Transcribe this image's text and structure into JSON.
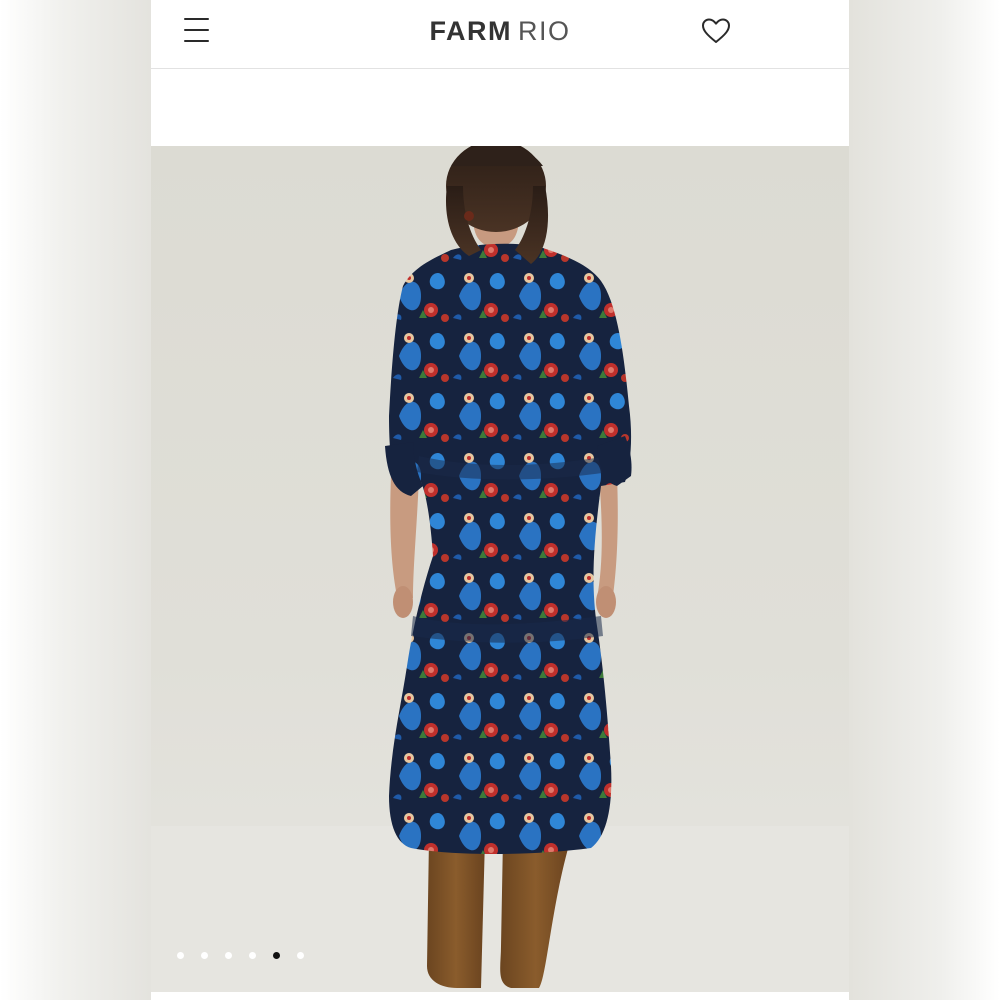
{
  "header": {
    "menu_icon": "hamburger-menu-icon",
    "brand_primary": "FARM",
    "brand_secondary": "RIO",
    "favorite_icon": "heart-outline-icon"
  },
  "gallery": {
    "image_description": "product-photo",
    "total_slides": 6,
    "active_slide": 5
  },
  "colors": {
    "background_left": "#e4e3de",
    "photo_bg": "#dcdbd3",
    "dress_navy": "#16233f",
    "dress_blue": "#2a73c2",
    "dress_red": "#c0302c",
    "boots": "#7a5126",
    "dot_active": "#111111",
    "dot_inactive": "#ffffff"
  }
}
